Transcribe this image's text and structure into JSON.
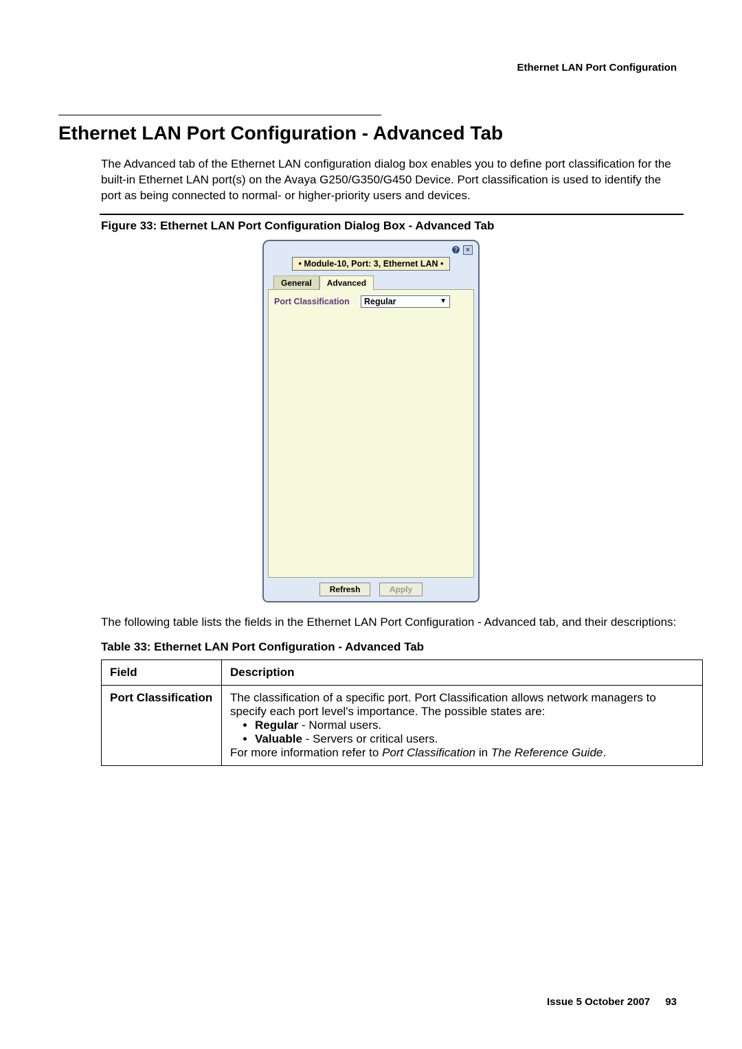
{
  "running_header": "Ethernet LAN Port Configuration",
  "section_title": "Ethernet LAN Port Configuration - Advanced Tab",
  "intro_paragraph": "The Advanced tab of the Ethernet LAN configuration dialog box enables you to define port classification for the built-in Ethernet LAN port(s) on the Avaya G250/G350/G450 Device. Port classification is used to identify the port as being connected to normal- or higher-priority users and devices.",
  "figure_caption": "Figure 33: Ethernet LAN Port Configuration Dialog Box - Advanced Tab",
  "dialog": {
    "breadcrumb": "• Module-10, Port: 3, Ethernet LAN •",
    "tab_general": "General",
    "tab_advanced": "Advanced",
    "field_label": "Port Classification",
    "field_value": "Regular",
    "btn_refresh": "Refresh",
    "btn_apply": "Apply",
    "close_glyph": "×",
    "help_glyph": "?"
  },
  "post_figure_text": "The following table lists the fields in the Ethernet LAN Port Configuration - Advanced tab, and their descriptions:",
  "table_caption": "Table 33: Ethernet LAN Port Configuration - Advanced Tab",
  "table": {
    "header_field": "Field",
    "header_desc": "Description",
    "row1_field": "Port Classification",
    "row1_desc_line1": "The classification of a specific port. Port Classification allows network managers to specify each port level's importance. The possible states are:",
    "row1_bullet1_bold": "Regular",
    "row1_bullet1_rest": " - Normal users.",
    "row1_bullet2_bold": "Valuable",
    "row1_bullet2_rest": " - Servers or critical users.",
    "row1_desc_last_pre": "For more information refer to ",
    "row1_desc_last_em1": "Port Classification",
    "row1_desc_last_mid": " in ",
    "row1_desc_last_em2": "The Reference Guide",
    "row1_desc_last_end": "."
  },
  "footer_issue": "Issue 5   October 2007",
  "footer_page": "93"
}
